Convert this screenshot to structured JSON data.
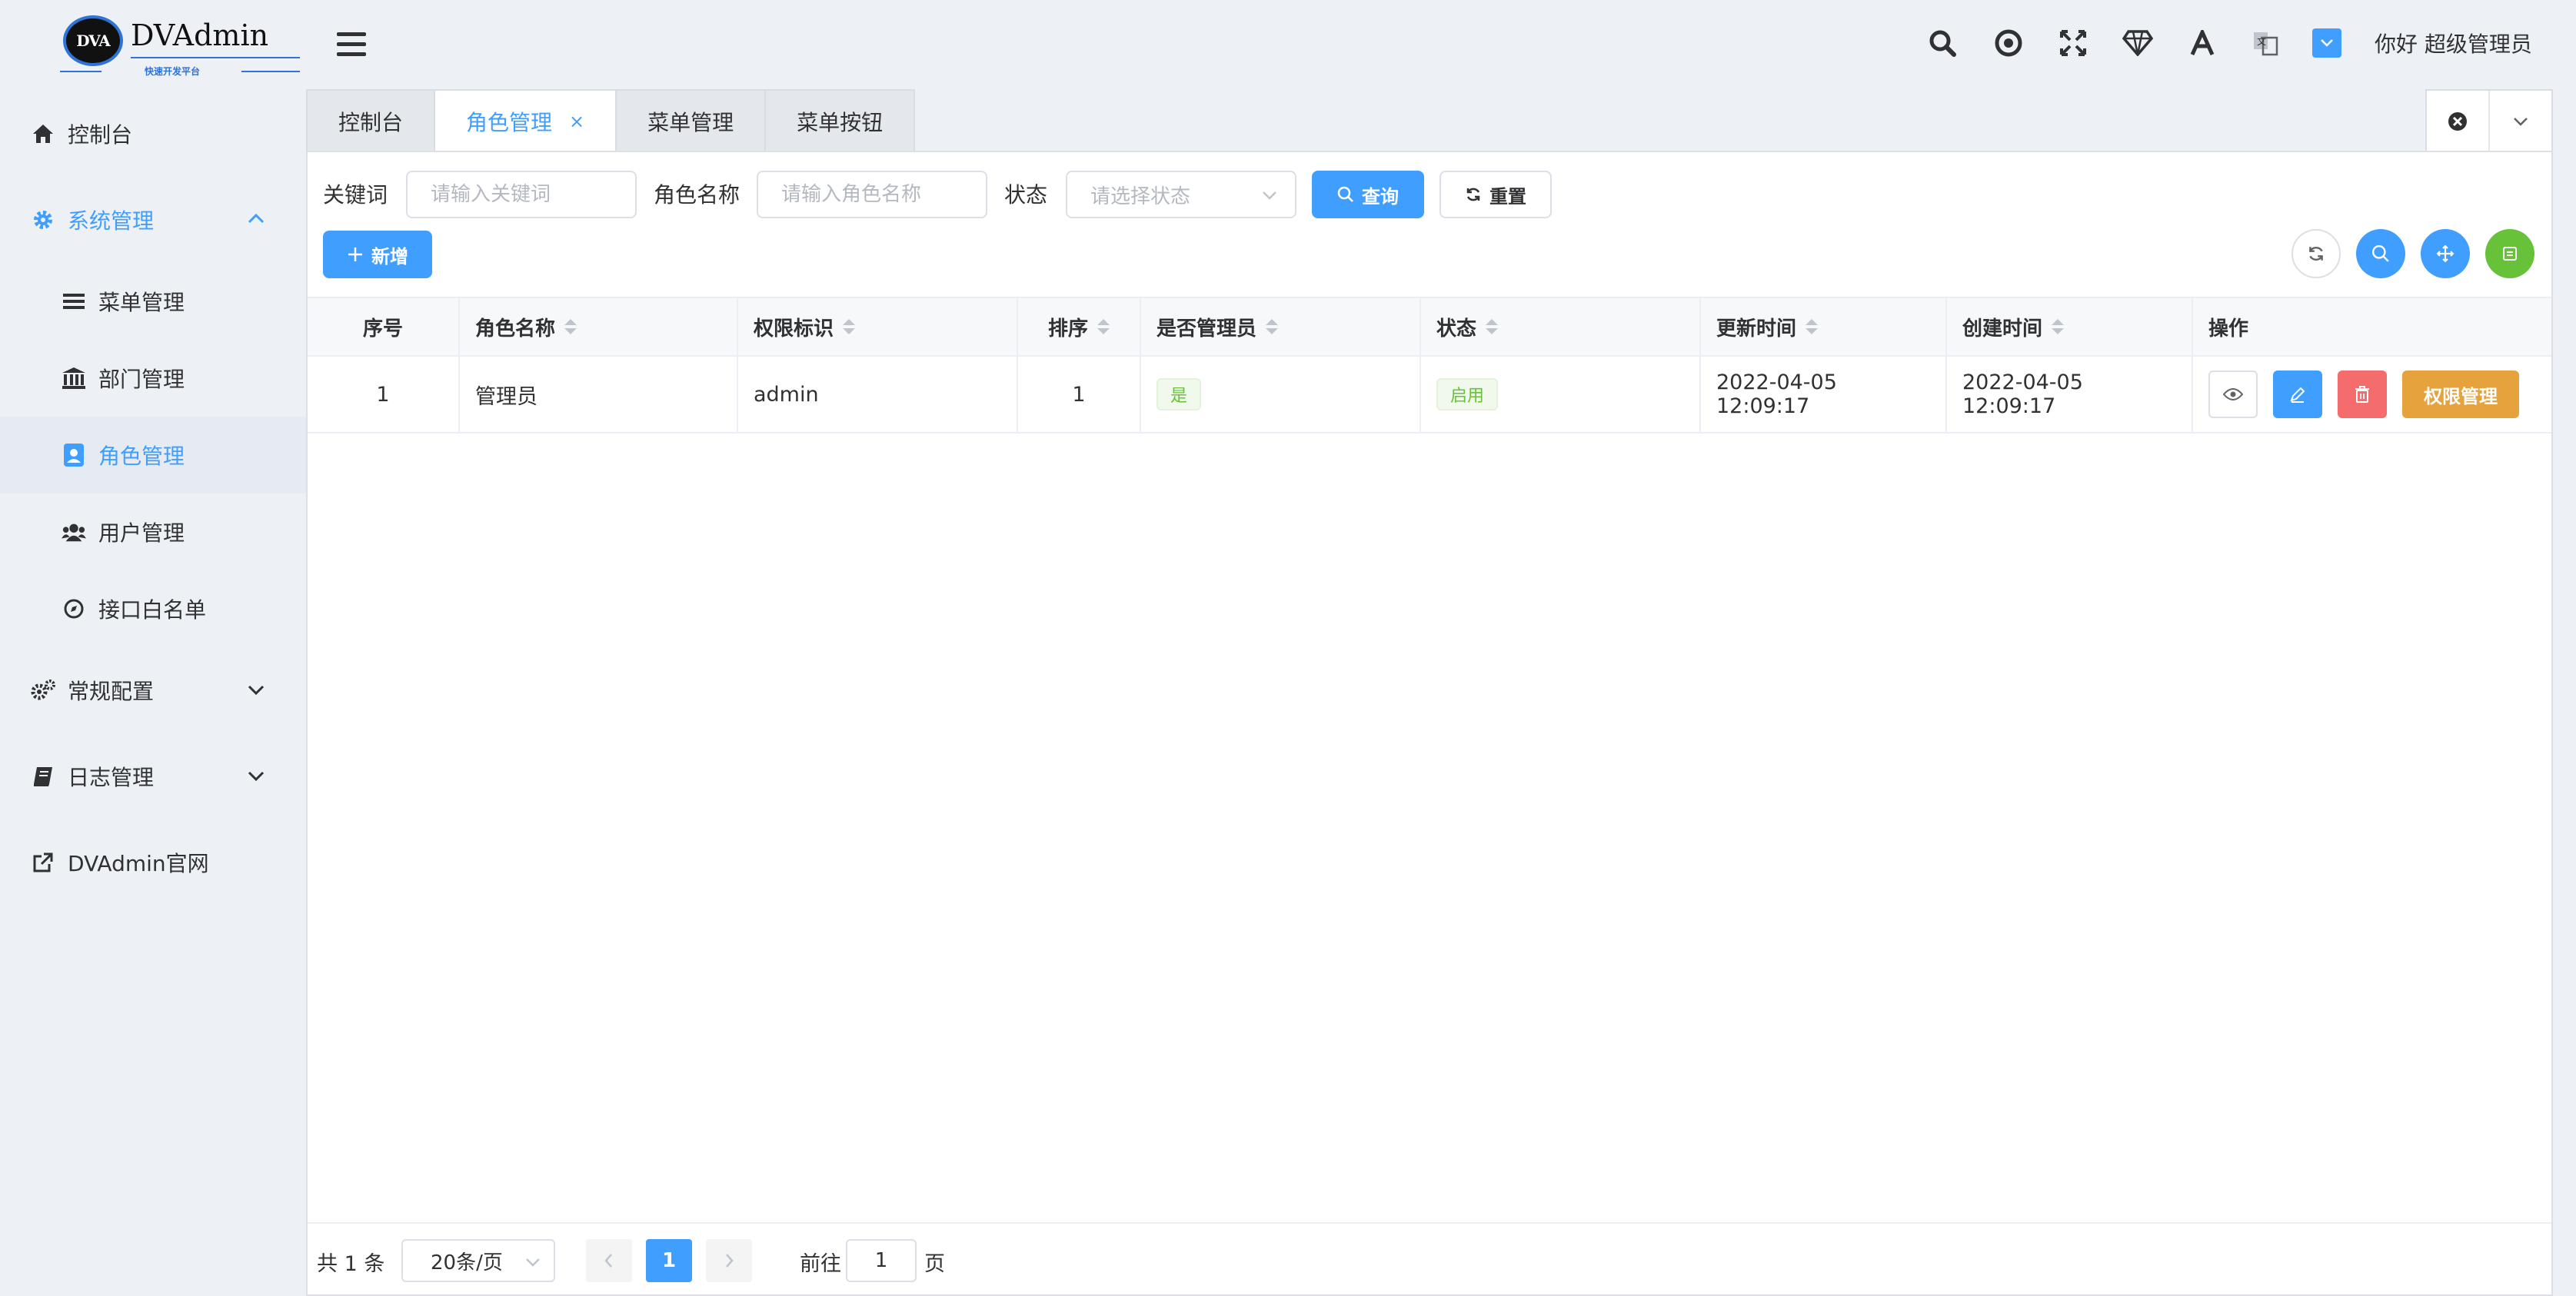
{
  "logo": {
    "badge": "DVA",
    "name": "DVAdmin",
    "slogan": "快速开发平台"
  },
  "sidebar": {
    "items": [
      {
        "label": "控制台",
        "icon": "home-icon"
      },
      {
        "label": "系统管理",
        "icon": "gear-icon"
      },
      {
        "label": "菜单管理",
        "icon": "list-icon"
      },
      {
        "label": "部门管理",
        "icon": "bank-icon"
      },
      {
        "label": "角色管理",
        "icon": "id-badge-icon"
      },
      {
        "label": "用户管理",
        "icon": "users-icon"
      },
      {
        "label": "接口白名单",
        "icon": "compass-icon"
      },
      {
        "label": "常规配置",
        "icon": "gears-icon"
      },
      {
        "label": "日志管理",
        "icon": "book-icon"
      },
      {
        "label": "DVAdmin官网",
        "icon": "external-link-icon"
      }
    ]
  },
  "header": {
    "greeting": "你好 超级管理员"
  },
  "tabs": [
    {
      "label": "控制台"
    },
    {
      "label": "角色管理"
    },
    {
      "label": "菜单管理"
    },
    {
      "label": "菜单按钮"
    }
  ],
  "filters": {
    "keyword_label": "关键词",
    "keyword_placeholder": "请输入关键词",
    "role_name_label": "角色名称",
    "role_name_placeholder": "请输入角色名称",
    "status_label": "状态",
    "status_placeholder": "请选择状态",
    "query_button": "查询",
    "reset_button": "重置"
  },
  "toolbar": {
    "add_button": "新增"
  },
  "table": {
    "columns": [
      "序号",
      "角色名称",
      "权限标识",
      "排序",
      "是否管理员",
      "状态",
      "更新时间",
      "创建时间",
      "操作"
    ],
    "rows": [
      {
        "index": "1",
        "name": "管理员",
        "key": "admin",
        "sort": "1",
        "is_admin": "是",
        "status": "启用",
        "updated": "2022-04-05 12:09:17",
        "created": "2022-04-05 12:09:17",
        "perm_button": "权限管理"
      }
    ]
  },
  "pagination": {
    "total": "共 1 条",
    "page_size": "20条/页",
    "current_page": "1",
    "goto_label": "前往",
    "goto_value": "1",
    "goto_suffix": "页"
  },
  "colors": {
    "primary": "#409eff",
    "danger": "#f56c6c",
    "warning": "#e6a23c",
    "success": "#67c23a"
  }
}
